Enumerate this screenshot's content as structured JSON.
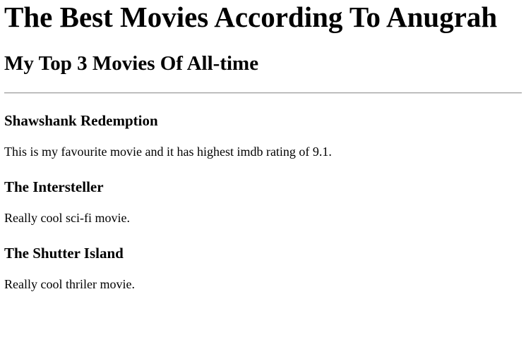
{
  "header": {
    "title": "The Best Movies According To Anugrah",
    "subtitle": "My Top 3 Movies Of All-time"
  },
  "movies": [
    {
      "name": "Shawshank Redemption",
      "description": "This is my favourite movie and it has highest imdb rating of 9.1."
    },
    {
      "name": "The Intersteller",
      "description": "Really cool sci-fi movie."
    },
    {
      "name": "The Shutter Island",
      "description": "Really cool thriler movie."
    }
  ]
}
